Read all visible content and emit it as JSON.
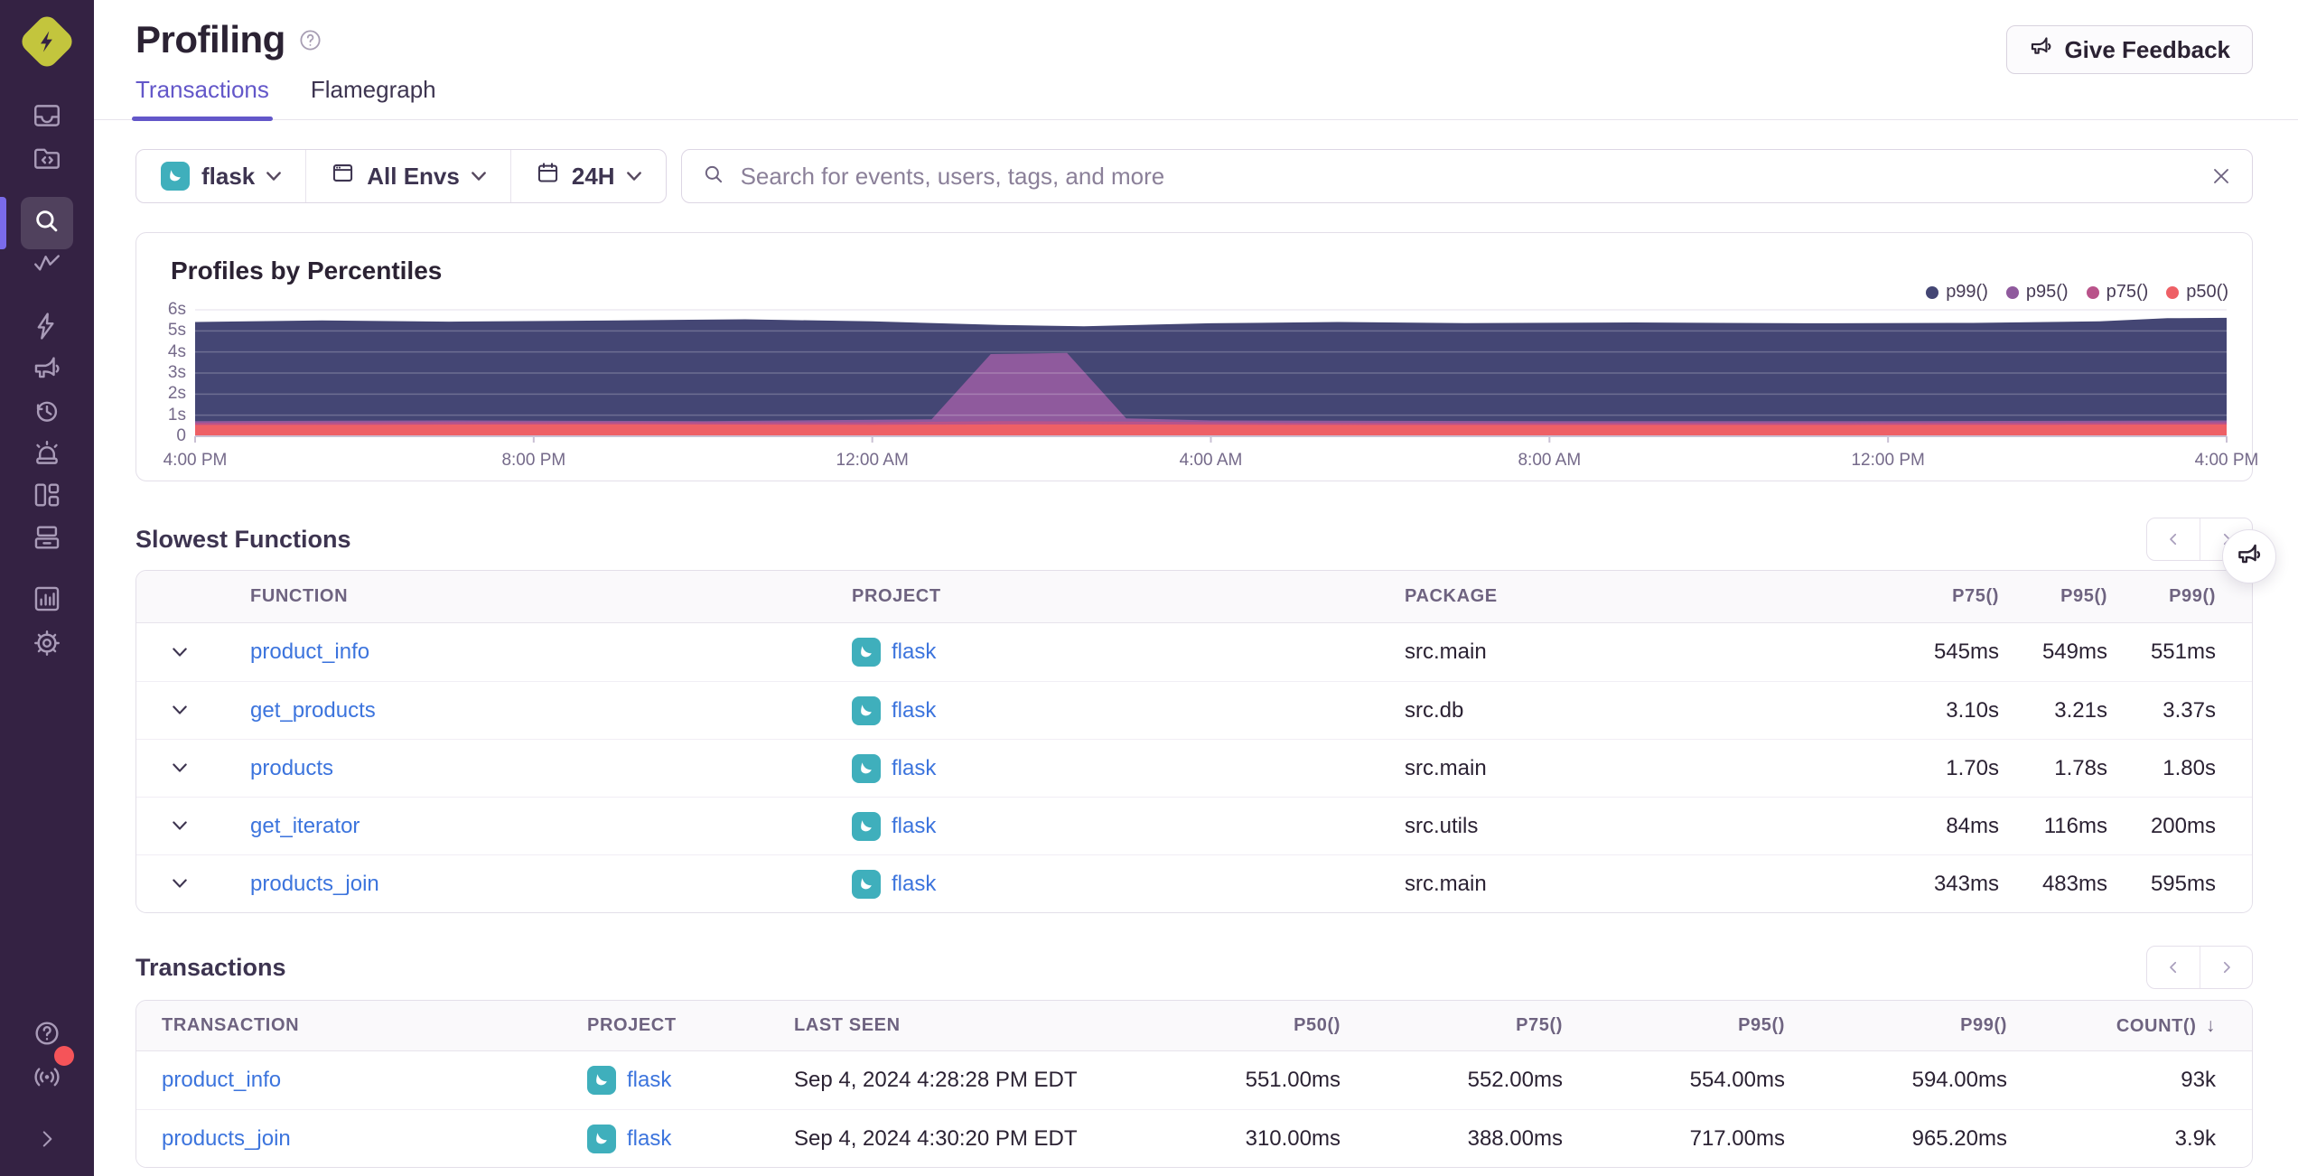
{
  "app": {
    "vendor": "sentry-logo"
  },
  "sidebar": {
    "active": "search",
    "icons": [
      "inbox",
      "code-folder",
      "search",
      "metrics-zigzag",
      "lightning",
      "megaphone-feedback",
      "replay-clock",
      "alerts-siren",
      "dashboard-blocks",
      "releases-archive",
      "stats-chart",
      "settings-gear",
      "help",
      "whats-new-broadcast",
      "collapse-chevron"
    ],
    "notification_dot_color": "#f55459"
  },
  "header": {
    "title": "Profiling",
    "feedback_button": "Give Feedback"
  },
  "tabs": [
    {
      "label": "Transactions",
      "active": true
    },
    {
      "label": "Flamegraph",
      "active": false
    }
  ],
  "filters": {
    "project": "flask",
    "environment": "All Envs",
    "date_range": "24H"
  },
  "search": {
    "placeholder": "Search for events, users, tags, and more"
  },
  "chart_data": {
    "type": "area",
    "title": "Profiles by Percentiles",
    "x_labels": [
      "4:00 PM",
      "8:00 PM",
      "12:00 AM",
      "4:00 AM",
      "8:00 AM",
      "12:00 PM",
      "4:00 PM"
    ],
    "x_range_hours": 24,
    "ylim": [
      0,
      6
    ],
    "ytick_labels": [
      "6s",
      "5s",
      "4s",
      "3s",
      "2s",
      "1s",
      "0"
    ],
    "grid": true,
    "legend_position": "top-right",
    "series": [
      {
        "name": "p99()",
        "color": "#444674",
        "points": [
          [
            0,
            5.42
          ],
          [
            1.5,
            5.5
          ],
          [
            3,
            5.44
          ],
          [
            5,
            5.5
          ],
          [
            6.5,
            5.55
          ],
          [
            8,
            5.45
          ],
          [
            9.5,
            5.28
          ],
          [
            10.5,
            5.22
          ],
          [
            12,
            5.36
          ],
          [
            13.5,
            5.42
          ],
          [
            15,
            5.37
          ],
          [
            17,
            5.4
          ],
          [
            19,
            5.36
          ],
          [
            21,
            5.38
          ],
          [
            22.5,
            5.45
          ],
          [
            23.3,
            5.6
          ],
          [
            24,
            5.62
          ]
        ]
      },
      {
        "name": "p95()",
        "color": "#8f5a9d",
        "points": [
          [
            0,
            0.72
          ],
          [
            3,
            0.75
          ],
          [
            6,
            0.72
          ],
          [
            8,
            0.78
          ],
          [
            8.7,
            0.8
          ],
          [
            9.4,
            3.9
          ],
          [
            10.3,
            3.95
          ],
          [
            11,
            0.85
          ],
          [
            12,
            0.75
          ],
          [
            16,
            0.72
          ],
          [
            20,
            0.72
          ],
          [
            24,
            0.75
          ]
        ]
      },
      {
        "name": "p75()",
        "color": "#b9538a",
        "points": [
          [
            0,
            0.64
          ],
          [
            3,
            0.67
          ],
          [
            8,
            0.66
          ],
          [
            9.5,
            0.72
          ],
          [
            11,
            0.7
          ],
          [
            13,
            0.64
          ],
          [
            18,
            0.63
          ],
          [
            24,
            0.66
          ]
        ]
      },
      {
        "name": "p50()",
        "color": "#ee6066",
        "points": [
          [
            0,
            0.54
          ],
          [
            2,
            0.55
          ],
          [
            5,
            0.57
          ],
          [
            8,
            0.55
          ],
          [
            10,
            0.56
          ],
          [
            14,
            0.54
          ],
          [
            19,
            0.54
          ],
          [
            22,
            0.55
          ],
          [
            24,
            0.56
          ]
        ]
      }
    ],
    "annotation": "p95 spike to ~3.9s between ~12:45 AM and ~3:00 AM"
  },
  "slowest_functions": {
    "title": "Slowest Functions",
    "columns": [
      "FUNCTION",
      "PROJECT",
      "PACKAGE",
      "P75()",
      "P95()",
      "P99()"
    ],
    "rows": [
      {
        "function": "product_info",
        "project": "flask",
        "package": "src.main",
        "p75": "545ms",
        "p95": "549ms",
        "p99": "551ms"
      },
      {
        "function": "get_products",
        "project": "flask",
        "package": "src.db",
        "p75": "3.10s",
        "p95": "3.21s",
        "p99": "3.37s"
      },
      {
        "function": "products",
        "project": "flask",
        "package": "src.main",
        "p75": "1.70s",
        "p95": "1.78s",
        "p99": "1.80s"
      },
      {
        "function": "get_iterator",
        "project": "flask",
        "package": "src.utils",
        "p75": "84ms",
        "p95": "116ms",
        "p99": "200ms"
      },
      {
        "function": "products_join",
        "project": "flask",
        "package": "src.main",
        "p75": "343ms",
        "p95": "483ms",
        "p99": "595ms"
      }
    ]
  },
  "transactions": {
    "title": "Transactions",
    "columns": [
      "TRANSACTION",
      "PROJECT",
      "LAST SEEN",
      "P50()",
      "P75()",
      "P95()",
      "P99()",
      "COUNT()"
    ],
    "sort_column": "COUNT()",
    "sort_indicator": "↓",
    "rows": [
      {
        "transaction": "product_info",
        "project": "flask",
        "last_seen": "Sep 4, 2024 4:28:28 PM EDT",
        "p50": "551.00ms",
        "p75": "552.00ms",
        "p95": "554.00ms",
        "p99": "594.00ms",
        "count": "93k"
      },
      {
        "transaction": "products_join",
        "project": "flask",
        "last_seen": "Sep 4, 2024 4:30:20 PM EDT",
        "p50": "310.00ms",
        "p75": "388.00ms",
        "p95": "717.00ms",
        "p99": "965.20ms",
        "count": "3.9k"
      }
    ]
  },
  "colors": {
    "accent": "#6357c9",
    "link": "#3c74dd",
    "project_badge": "#3fafbc",
    "sidebar_bg": "#342243",
    "sidebar_accent": "#7a6bea",
    "logo": "#c3c53d",
    "p99": "#444674",
    "p95": "#8f5a9d",
    "p75": "#b9538a",
    "p50": "#ee6066"
  }
}
